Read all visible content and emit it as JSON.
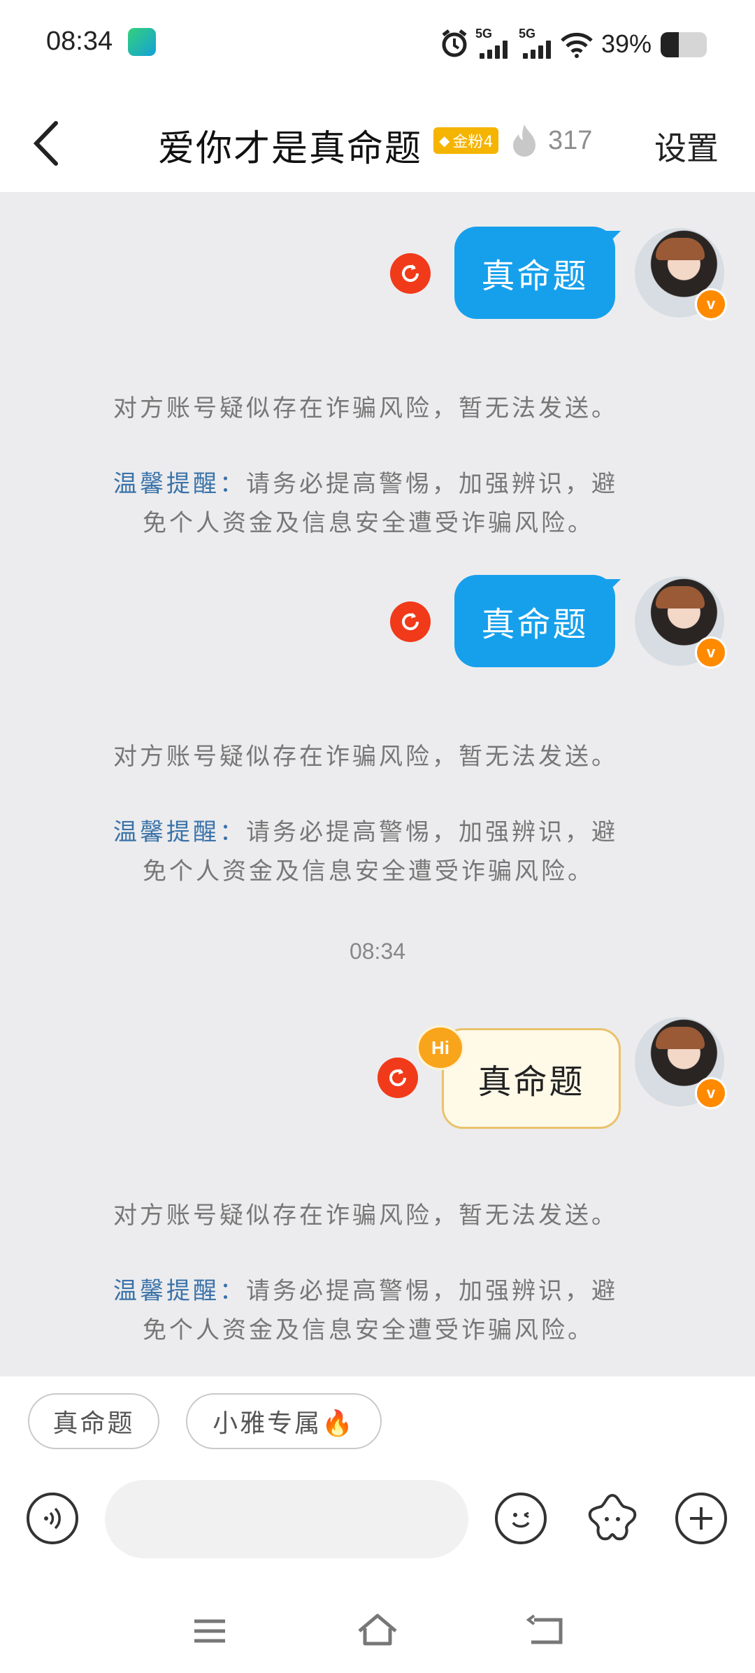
{
  "status_bar": {
    "time": "08:34",
    "network1": "5G",
    "network2": "5G",
    "battery": "39%",
    "battery_level": 0.39
  },
  "header": {
    "back_icon": "chevron-left-icon",
    "title": "爱你才是真命题",
    "fan_badge": "金粉4",
    "fire_count": "317",
    "settings": "设置"
  },
  "messages": [
    {
      "text": "真命题",
      "type": "normal"
    },
    {
      "text": "真命题",
      "type": "normal"
    },
    {
      "text": "真命题",
      "type": "hi",
      "hi_label": "Hi"
    }
  ],
  "system_notice": {
    "warning": "对方账号疑似存在诈骗风险，暂无法发送。",
    "tip_label": "温馨提醒：",
    "tip_text_line1": "请务必提高警惕，加强辨识，避",
    "tip_text_line2": "免个人资金及信息安全遭受诈骗风险。"
  },
  "timestamp": "08:34",
  "quick_replies": [
    {
      "label": "真命题"
    },
    {
      "label": "小雅专属🔥"
    }
  ],
  "input": {
    "placeholder": ""
  },
  "colors": {
    "bubble_blue": "#16a0ec",
    "resend_red": "#f13a1a",
    "tip_blue": "#3b73a9",
    "fan_gold": "#f5b400"
  }
}
